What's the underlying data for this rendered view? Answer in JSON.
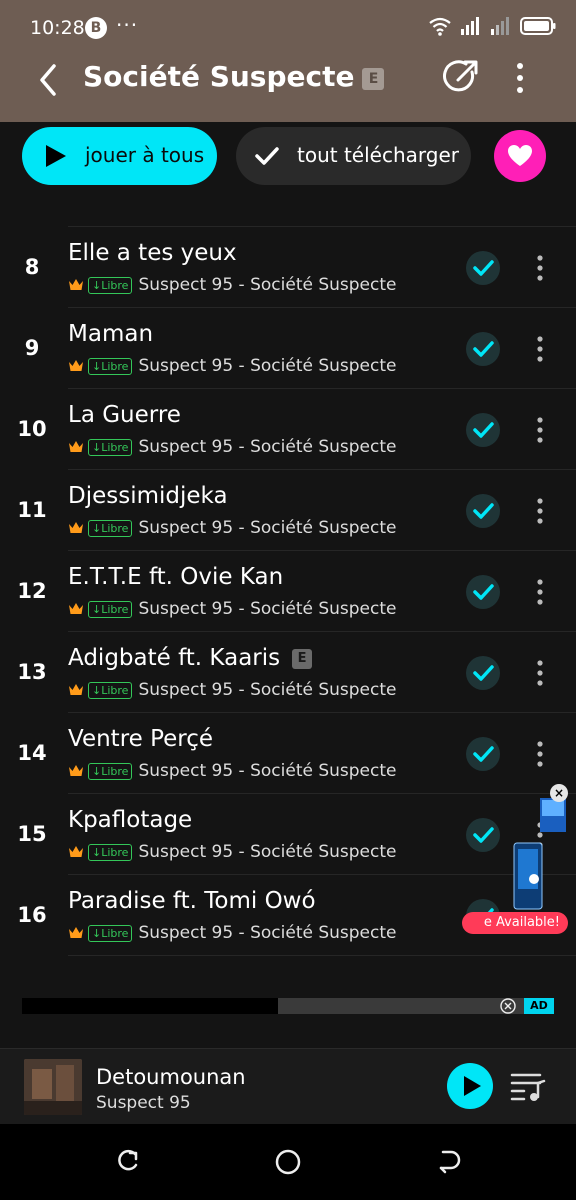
{
  "status_bar": {
    "time": "10:28",
    "b_icon": "B",
    "overflow_dots": "···"
  },
  "header": {
    "title": "Société Suspecte",
    "explicit_badge": "E"
  },
  "actions": {
    "play_all_label": "jouer à tous",
    "download_all_label": "tout télécharger"
  },
  "tracks": [
    {
      "num": "8",
      "title": "Elle a tes yeux",
      "explicit": false,
      "libre": "↓Libre",
      "subtitle": "Suspect 95 - Société Suspecte"
    },
    {
      "num": "9",
      "title": "Maman",
      "explicit": false,
      "libre": "↓Libre",
      "subtitle": "Suspect 95 - Société Suspecte"
    },
    {
      "num": "10",
      "title": "La Guerre",
      "explicit": false,
      "libre": "↓Libre",
      "subtitle": "Suspect 95 - Société Suspecte"
    },
    {
      "num": "11",
      "title": "Djessimidjeka",
      "explicit": false,
      "libre": "↓Libre",
      "subtitle": "Suspect 95 - Société Suspecte"
    },
    {
      "num": "12",
      "title": "E.T.T.E ft. Ovie Kan",
      "explicit": false,
      "libre": "↓Libre",
      "subtitle": "Suspect 95 - Société Suspecte"
    },
    {
      "num": "13",
      "title": "Adigbaté ft. Kaaris",
      "explicit": true,
      "explicit_badge": "E",
      "libre": "↓Libre",
      "subtitle": "Suspect 95 - Société Suspecte"
    },
    {
      "num": "14",
      "title": "Ventre Perçé",
      "explicit": false,
      "libre": "↓Libre",
      "subtitle": "Suspect 95 - Société Suspecte"
    },
    {
      "num": "15",
      "title": "Kpaflotage",
      "explicit": false,
      "libre": "↓Libre",
      "subtitle": "Suspect 95 - Société Suspecte"
    },
    {
      "num": "16",
      "title": "Paradise ft. Tomi Owó",
      "explicit": false,
      "libre": "↓Libre",
      "subtitle": "Suspect 95 - Société Suspecte"
    }
  ],
  "ad_banner": {
    "label": "AD"
  },
  "floating_ad": {
    "text": "e Available!",
    "close": "×"
  },
  "player": {
    "title": "Detoumounan",
    "artist": "Suspect 95"
  },
  "colors": {
    "accent": "#00e6f7",
    "header_bg": "#6e5d53",
    "heart": "#ff1fb7",
    "libre_green": "#34c759",
    "crown": "#ff9b1a"
  }
}
